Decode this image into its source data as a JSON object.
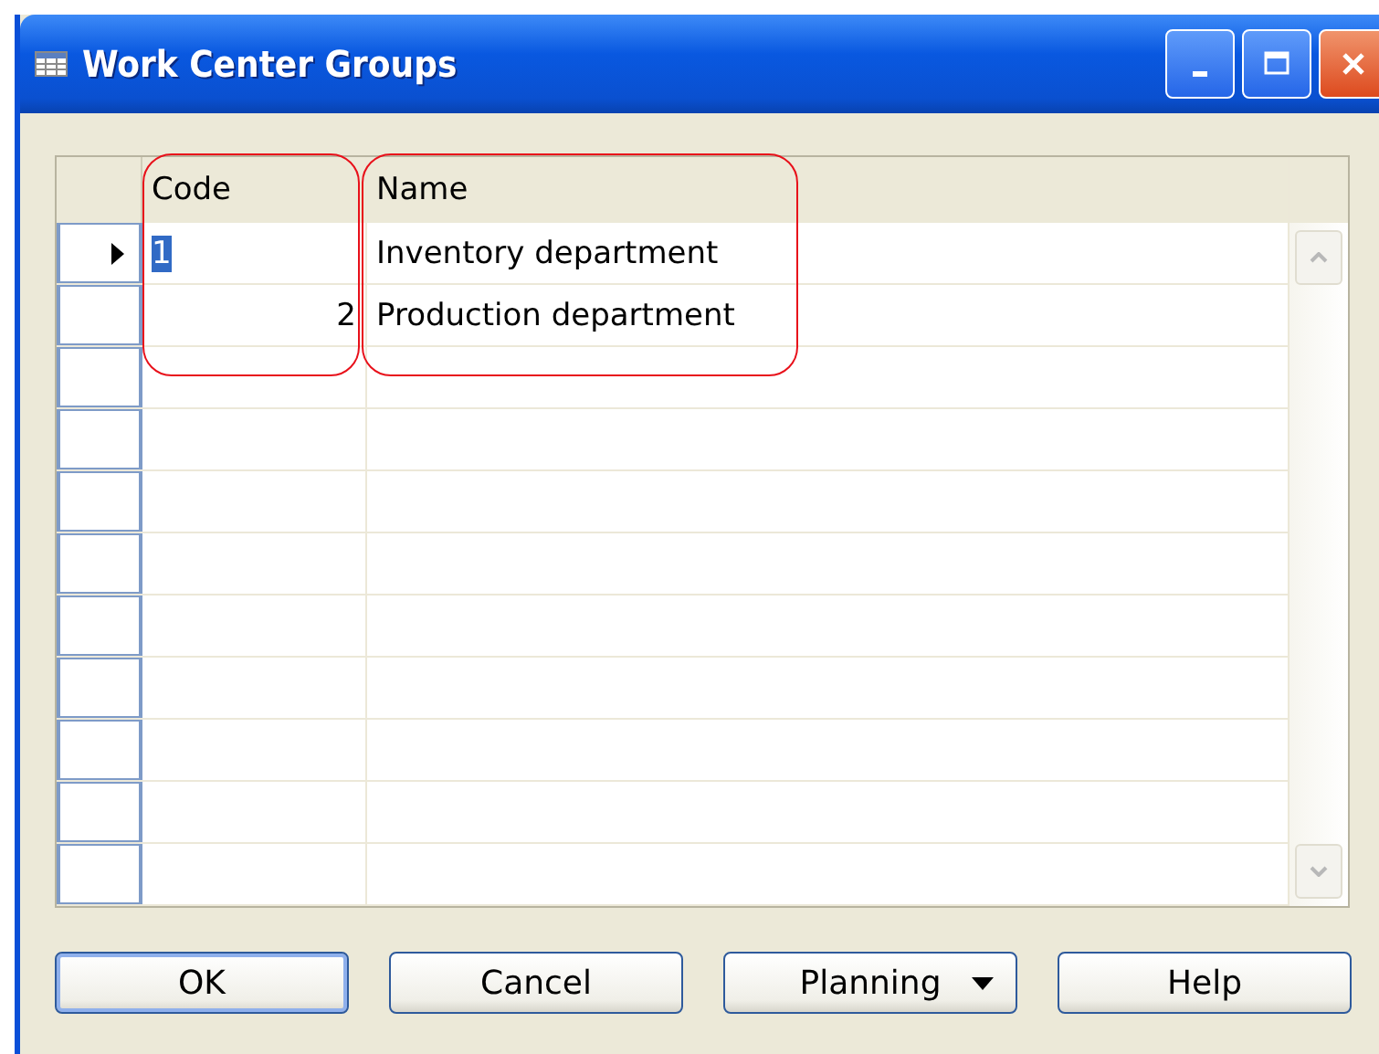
{
  "window": {
    "title": "Work Center Groups"
  },
  "table": {
    "columns": [
      "Code",
      "Name"
    ],
    "rows": [
      {
        "code": "1",
        "name": "Inventory department",
        "selected": true
      },
      {
        "code": "2",
        "name": "Production department",
        "selected": false
      }
    ]
  },
  "buttons": [
    {
      "label": "OK",
      "kind": "plain",
      "default": true
    },
    {
      "label": "Cancel",
      "kind": "plain",
      "default": false
    },
    {
      "label": "Planning",
      "kind": "dropdown",
      "default": false
    },
    {
      "label": "Help",
      "kind": "plain",
      "default": false
    }
  ]
}
